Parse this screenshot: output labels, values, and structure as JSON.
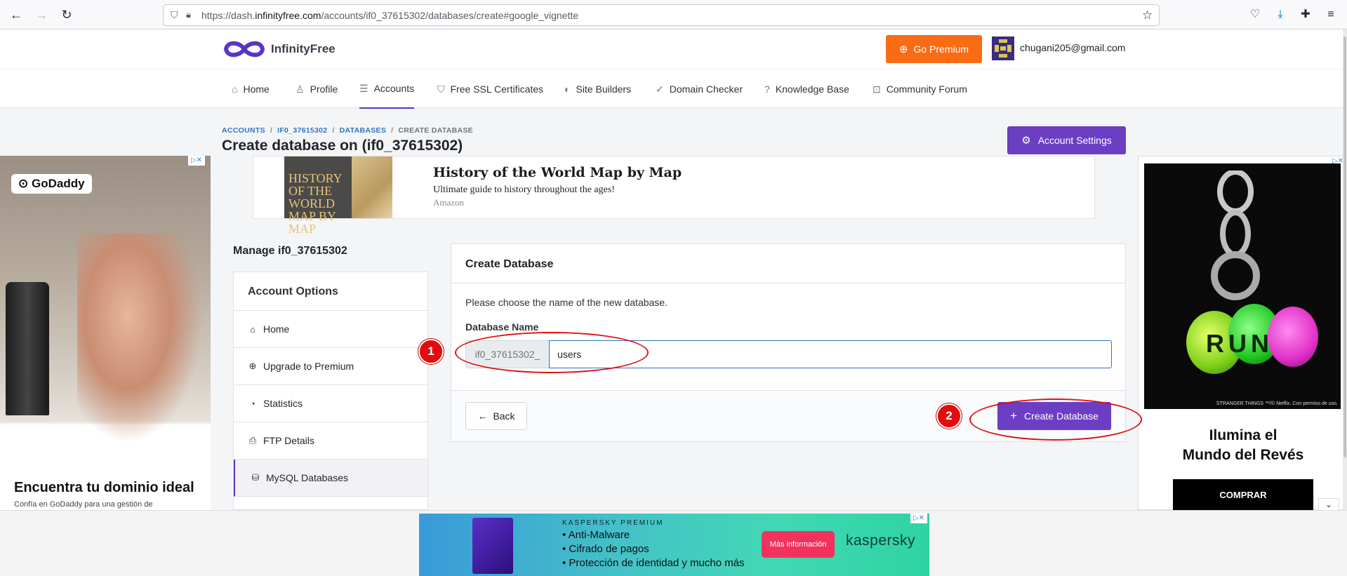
{
  "browser": {
    "url_prefix": "https://dash.",
    "url_domain": "infinityfree.com",
    "url_path": "/accounts/if0_37615302/databases/create#google_vignette"
  },
  "header": {
    "brand": "InfinityFree",
    "go_premium_label": "Go Premium",
    "user_email": "chugani205@gmail.com"
  },
  "nav": {
    "items": [
      {
        "label": "Home",
        "icon": "home-icon"
      },
      {
        "label": "Profile",
        "icon": "user-icon"
      },
      {
        "label": "Accounts",
        "icon": "server-icon"
      },
      {
        "label": "Free SSL Certificates",
        "icon": "shield-icon"
      },
      {
        "label": "Site Builders",
        "icon": "palette-icon"
      },
      {
        "label": "Domain Checker",
        "icon": "check-circle-icon"
      },
      {
        "label": "Knowledge Base",
        "icon": "question-circle-icon"
      },
      {
        "label": "Community Forum",
        "icon": "comments-icon"
      }
    ],
    "active": "Accounts"
  },
  "breadcrumb": {
    "items": [
      "ACCOUNTS",
      "IF0_37615302",
      "DATABASES",
      "CREATE DATABASE"
    ]
  },
  "page": {
    "title": "Create database on (if0_37615302)",
    "account_settings_label": "Account Settings"
  },
  "ads": {
    "top": {
      "book_cover": "HISTORY OF THE WORLD MAP BY MAP",
      "title": "History of the World Map by Map",
      "description": "Ultimate guide to history throughout the ages!",
      "source": "Amazon"
    },
    "left": {
      "brand": "GoDaddy",
      "headline": "Encuentra tu dominio ideal",
      "sub": "Confía en GoDaddy para una gestión de"
    },
    "right": {
      "headline_line1": "Ilumina el",
      "headline_line2": "Mundo del Revés",
      "cta": "COMPRAR",
      "credit": "STRANGER THINGS ™/© Netflix. Con permiso de uso.",
      "orb_text": "RUN"
    },
    "bottom": {
      "brand_line": "KASPERSKY PREMIUM",
      "bullets": [
        "• Anti-Malware",
        "• Cifrado de pagos",
        "• Protección de identidad y mucho más"
      ],
      "cta": "Más información",
      "logo": "kaspersky"
    }
  },
  "sidebar": {
    "manage_title": "Manage if0_37615302",
    "header": "Account Options",
    "items": [
      {
        "label": "Home",
        "icon": "home-icon"
      },
      {
        "label": "Upgrade to Premium",
        "icon": "arrow-up-circle-icon"
      },
      {
        "label": "Statistics",
        "icon": "pie-chart-icon"
      },
      {
        "label": "FTP Details",
        "icon": "file-upload-icon"
      },
      {
        "label": "MySQL Databases",
        "icon": "database-icon"
      }
    ],
    "active": "MySQL Databases"
  },
  "form": {
    "card_title": "Create Database",
    "description": "Please choose the name of the new database.",
    "field_label": "Database Name",
    "prefix": "if0_37615302_",
    "value": "users",
    "back_label": "Back",
    "submit_label": "Create Database"
  },
  "annotations": {
    "markers": [
      "1",
      "2"
    ],
    "color": "#e30c0c"
  },
  "colors": {
    "primary": "#6b3ec4",
    "premium_orange": "#f96c15",
    "link_blue": "#2f74c0"
  }
}
